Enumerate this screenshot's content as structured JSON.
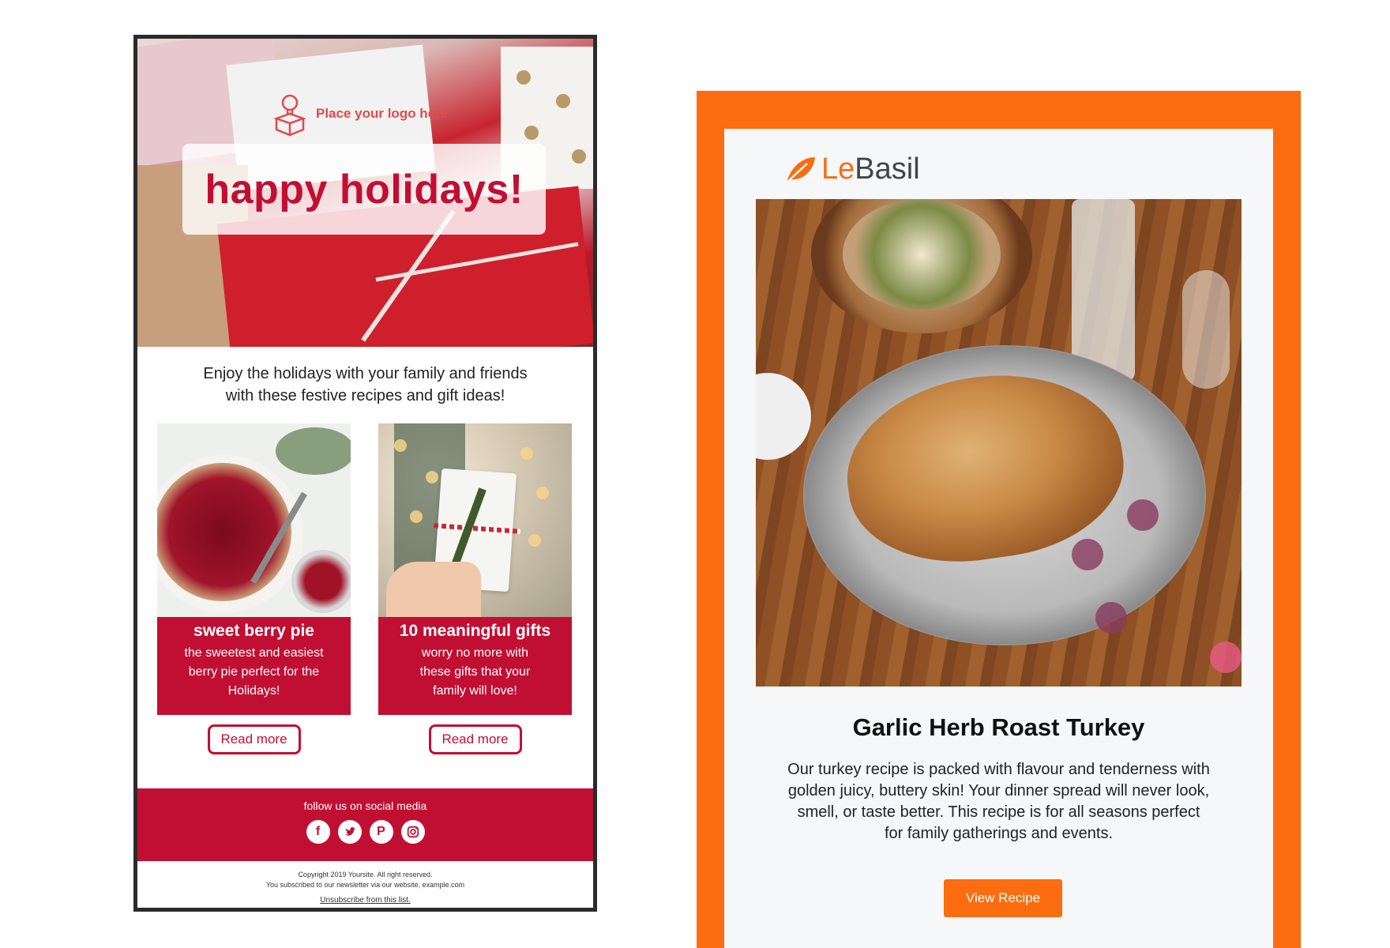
{
  "left_email": {
    "logo_text": "Place your logo here",
    "headline": "happy holidays!",
    "intro_line1": "Enjoy the holidays with your family and friends",
    "intro_line2": "with these festive recipes and gift ideas!",
    "cards": [
      {
        "title": "sweet berry pie",
        "desc_line1": "the sweetest and easiest",
        "desc_line2": "berry pie perfect for the",
        "desc_line3": "Holidays!",
        "button": "Read more"
      },
      {
        "title": "10 meaningful gifts",
        "desc_line1": "worry no more with",
        "desc_line2": "these gifts that your",
        "desc_line3": "family will love!",
        "button": "Read more"
      }
    ],
    "social": {
      "label": "follow us on social media",
      "icons": [
        "facebook-icon",
        "twitter-icon",
        "pinterest-icon",
        "instagram-icon"
      ]
    },
    "footer": {
      "copyright": "Copyright 2019 Yoursite. All right reserved.",
      "subscribed": "You subscribed to our newsletter via our website, example.com",
      "unsubscribe": "Unsubscribe from this list."
    },
    "colors": {
      "accent": "#c10f33"
    }
  },
  "right_email": {
    "brand_le": "Le",
    "brand_basil": "Basil",
    "recipe_title": "Garlic Herb Roast Turkey",
    "desc_line1": "Our turkey recipe is packed with flavour and tenderness with",
    "desc_line2": "golden juicy, buttery skin! Your dinner spread will never look,",
    "desc_line3": "smell, or taste better. This recipe is for all seasons perfect",
    "desc_line4": "for family gatherings and events.",
    "button": "View Recipe",
    "colors": {
      "accent": "#fb6d10",
      "background": "#f6f7f8"
    }
  }
}
